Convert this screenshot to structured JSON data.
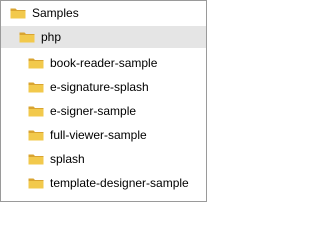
{
  "tree": {
    "root": {
      "label": "Samples",
      "icon": "folder-icon"
    },
    "selected": {
      "label": "php",
      "icon": "folder-icon"
    },
    "children": [
      {
        "label": "book-reader-sample",
        "icon": "folder-icon"
      },
      {
        "label": "e-signature-splash",
        "icon": "folder-icon"
      },
      {
        "label": "e-signer-sample",
        "icon": "folder-icon"
      },
      {
        "label": "full-viewer-sample",
        "icon": "folder-icon"
      },
      {
        "label": "splash",
        "icon": "folder-icon"
      },
      {
        "label": "template-designer-sample",
        "icon": "folder-icon"
      }
    ],
    "colors": {
      "folder_back": "#d9a431",
      "folder_front": "#f2c94c",
      "selection": "#e5e5e5",
      "border": "#9a9a9a"
    }
  }
}
